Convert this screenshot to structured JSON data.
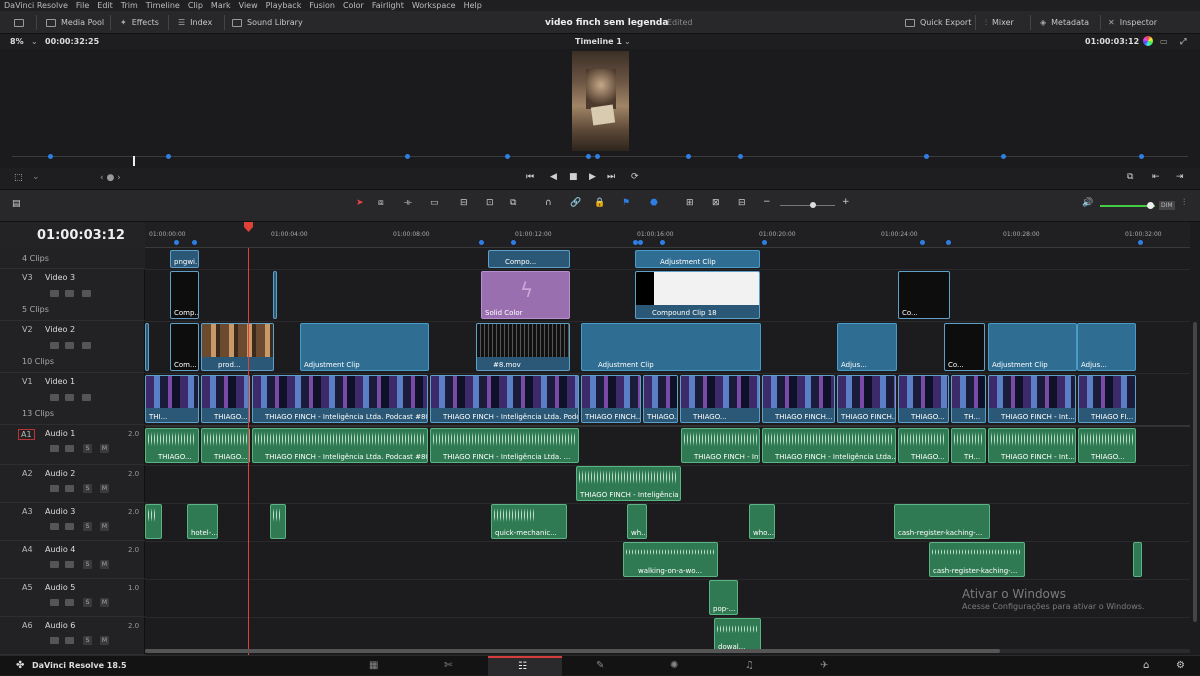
{
  "menu": [
    "DaVinci Resolve",
    "File",
    "Edit",
    "Trim",
    "Timeline",
    "Clip",
    "Mark",
    "View",
    "Playback",
    "Fusion",
    "Color",
    "Fairlight",
    "Workspace",
    "Help"
  ],
  "toolbar": {
    "media_pool": "Media Pool",
    "effects": "Effects",
    "index": "Index",
    "sound_library": "Sound Library",
    "project_title": "video finch sem legenda",
    "edited": "Edited",
    "quick_export": "Quick Export",
    "mixer": "Mixer",
    "metadata": "Metadata",
    "inspector": "Inspector"
  },
  "viewer": {
    "zoom": "8%",
    "duration": "00:00:32:25",
    "timeline_name": "Timeline 1",
    "timecode": "01:00:03:12"
  },
  "timeline": {
    "timecode": "01:00:03:12",
    "ruler": [
      "01:00:00:00",
      "01:00:04:00",
      "01:00:08:00",
      "01:00:12:00",
      "01:00:16:00",
      "01:00:20:00",
      "01:00:24:00",
      "01:00:28:00",
      "01:00:32:00"
    ],
    "dim": "DIM"
  },
  "tracks": [
    {
      "id": "",
      "name": "",
      "clips": "4 Clips"
    },
    {
      "id": "V3",
      "name": "Video 3",
      "clips": "5 Clips"
    },
    {
      "id": "V2",
      "name": "Video 2",
      "clips": "10 Clips"
    },
    {
      "id": "V1",
      "name": "Video 1",
      "clips": "13 Clips"
    },
    {
      "id": "A1",
      "name": "Audio 1",
      "db": "2.0"
    },
    {
      "id": "A2",
      "name": "Audio 2",
      "db": "2.0"
    },
    {
      "id": "A3",
      "name": "Audio 3",
      "db": "2.0"
    },
    {
      "id": "A4",
      "name": "Audio 4",
      "db": "2.0"
    },
    {
      "id": "A5",
      "name": "Audio 5",
      "db": "1.0"
    },
    {
      "id": "A6",
      "name": "Audio 6",
      "db": "2.0"
    }
  ],
  "clips": {
    "v4": [
      "pngwi...",
      "Compo...",
      "Adjustment Clip"
    ],
    "v3": [
      "Comp...",
      "Solid Color",
      "Compound Clip 18",
      "Co..."
    ],
    "v2": [
      "Com...",
      "prod...",
      "Adjustment Clip",
      "#8.mov",
      "Adjustment Clip",
      "Adjus...",
      "Co...",
      "Adjustment Clip",
      "Adjus..."
    ],
    "v1": [
      "THI...",
      "THIAGO...",
      "THIAGO FINCH - Inteligência Ltda. Podcast #80...",
      "THIAGO FINCH - Inteligência Ltda. Podca...",
      "THIAGO FINCH...",
      "THIAGO...",
      "THIAGO...",
      "THIAGO FINCH...",
      "THIAGO...",
      "TH...",
      "THIAGO FINCH - Int...",
      "THIAGO FI..."
    ],
    "a1": [
      "THIAGO...",
      "THIAGO...",
      "THIAGO FINCH - Inteligência Ltda. Podcast #80...",
      "THIAGO FINCH - Inteligência Ltda. ...",
      "THIAGO FINCH - Inte...",
      "THIAGO FINCH - Inteligência Ltda....",
      "THIAGO...",
      "TH...",
      "THIAGO FINCH - Int...",
      "THIAGO..."
    ],
    "a2": [
      "THIAGO FINCH - Inteligência ..."
    ],
    "a3": [
      "hotel-...",
      "quick-mechanic...",
      "wh...",
      "who...",
      "cash-register-kaching-..."
    ],
    "a4": [
      "walking-on-a-wo...",
      "cash-register-kaching-..."
    ],
    "a5": [
      "pop-..."
    ],
    "a6": [
      "dowal..."
    ]
  },
  "watermark": {
    "title": "Ativar o Windows",
    "subtitle": "Acesse Configurações para ativar o Windows."
  },
  "bottom": {
    "app": "DaVinci Resolve 18.5"
  },
  "colors": {
    "accent": "#2d7fe6",
    "playhead": "#e0403a",
    "video_clip": "#2b5876",
    "adjustment": "#2f6e92",
    "audio": "#2f7a52",
    "solid": "#9a6fb0"
  }
}
